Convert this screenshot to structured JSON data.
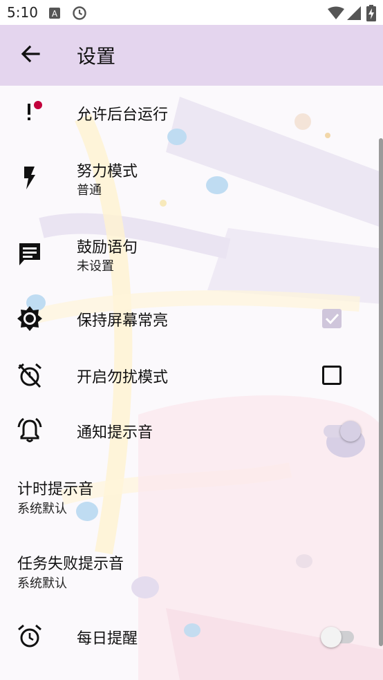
{
  "status_bar": {
    "time": "5:10",
    "icons": [
      "a-box-icon",
      "clock-icon",
      "wifi-icon",
      "signal-icon",
      "battery-charging-icon"
    ]
  },
  "app_bar": {
    "title": "设置",
    "back_icon": "arrow-left-icon"
  },
  "settings": [
    {
      "id": "background-run",
      "label": "允许后台运行",
      "icon": "exclamation-badge-icon",
      "badge_color": "#c2003c"
    },
    {
      "id": "effort-mode",
      "label": "努力模式",
      "sub": "普通",
      "icon": "flash-icon"
    },
    {
      "id": "encourage-text",
      "label": "鼓励语句",
      "sub": "未设置",
      "icon": "message-icon"
    },
    {
      "id": "keep-screen-on",
      "label": "保持屏幕常亮",
      "icon": "brightness-icon",
      "checked": true
    },
    {
      "id": "do-not-disturb",
      "label": "开启勿扰模式",
      "icon": "alarm-off-icon",
      "checked": false
    },
    {
      "id": "notification-sound",
      "label": "通知提示音",
      "icon": "bell-ring-icon",
      "on": false
    },
    {
      "id": "timer-sound",
      "label": "计时提示音",
      "sub": "系统默认"
    },
    {
      "id": "task-fail-sound",
      "label": "任务失败提示音",
      "sub": "系统默认"
    },
    {
      "id": "daily-reminder",
      "label": "每日提醒",
      "icon": "alarm-icon",
      "on": false
    }
  ],
  "colors": {
    "app_bar": "#e4d5ee",
    "badge": "#c2003c",
    "checkbox_checked": "#cfc6db",
    "switch_thumb_off": "#d7d0e4"
  }
}
